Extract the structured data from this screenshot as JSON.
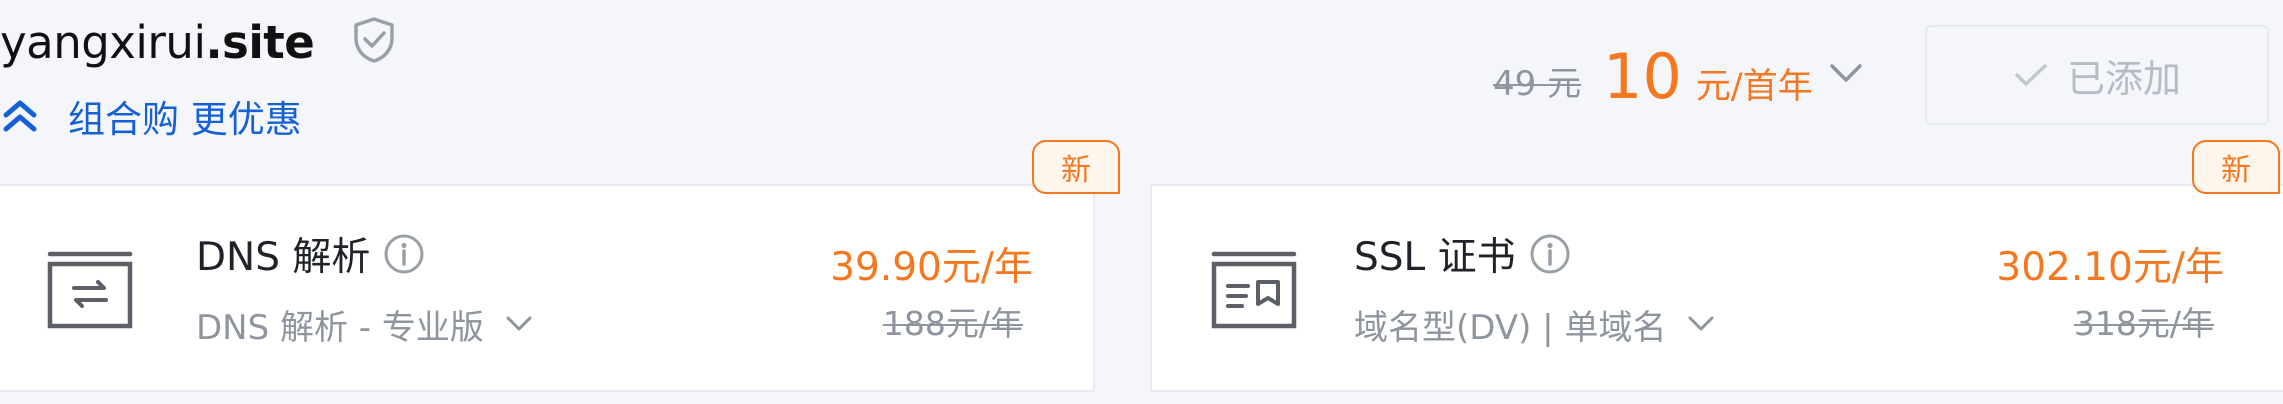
{
  "domain": {
    "name": "yangxirui",
    "suffix": ".site",
    "shield_icon": "shield-check-icon"
  },
  "promo": {
    "icon": "double-chevron-up-icon",
    "label": "组合购 更优惠"
  },
  "pricing": {
    "original": "49 元",
    "current": "10",
    "unit": "元/首年",
    "dropdown_icon": "chevron-down-icon"
  },
  "add_button": {
    "icon": "check-icon",
    "label": "已添加"
  },
  "products": [
    {
      "badge": "新",
      "icon": "dns-exchange-icon",
      "name": "DNS 解析",
      "info_icon": "info-icon",
      "spec": "DNS 解析 - 专业版",
      "price": "39.90元/年",
      "original_price": "188元/年"
    },
    {
      "badge": "新",
      "icon": "ssl-certificate-icon",
      "name": "SSL 证书",
      "info_icon": "info-icon",
      "spec": "域名型(DV) | 单域名",
      "price": "302.10元/年",
      "original_price": "318元/年"
    }
  ],
  "colors": {
    "accent": "#f5771f",
    "link": "#1660d6",
    "muted": "#8f959e",
    "background": "#f4f6fb"
  }
}
